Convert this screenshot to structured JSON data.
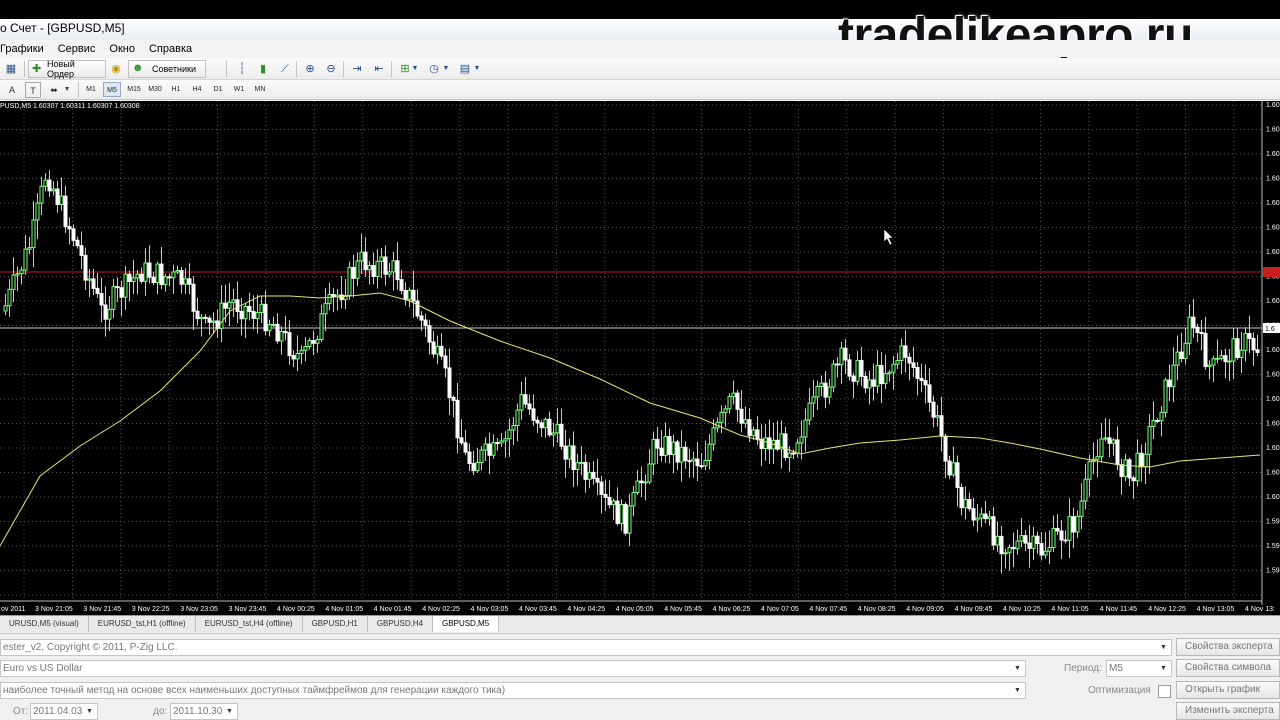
{
  "window": {
    "title": "о Счет - [GBPUSD,M5]",
    "watermark": "tradelikeapro.ru"
  },
  "menu": [
    "Графики",
    "Сервис",
    "Окно",
    "Справка"
  ],
  "toolbar": {
    "new_order": "Новый Ордер",
    "advisors": "Советники",
    "timeframes": [
      "M1",
      "M5",
      "M15",
      "M30",
      "H1",
      "H4",
      "D1",
      "W1",
      "MN"
    ],
    "active_timeframe": "M5",
    "text_tool_a": "A",
    "text_tool_t": "T"
  },
  "chart": {
    "header": "PUSD,M5  1.60307 1.60311 1.60307 1.60308",
    "background": "#000000",
    "grid_color": "#555555",
    "bull_color": "#7cff7c",
    "bear_color": "#ffffff",
    "ma_color": "#e6e67a",
    "hline_red": "#c81e1e",
    "hline_white": "#c8c8c8",
    "price_labels": [
      "1.60",
      "1.60",
      "1.60",
      "1.60",
      "1.60",
      "1.60",
      "1.60",
      "1.60",
      "1.60",
      "1.60",
      "1.60",
      "1.60",
      "1.60",
      "1.60",
      "1.60",
      "1.60",
      "1.60",
      "1.59",
      "1.59",
      "1.59"
    ],
    "time_labels": [
      "ov 2011",
      "3 Nov 21:05",
      "3 Nov 21:45",
      "3 Nov 22:25",
      "3 Nov 23:05",
      "3 Nov 23:45",
      "4 Nov 00:25",
      "4 Nov 01:05",
      "4 Nov 01:45",
      "4 Nov 02:25",
      "4 Nov 03:05",
      "4 Nov 03:45",
      "4 Nov 04:25",
      "4 Nov 05:05",
      "4 Nov 05:45",
      "4 Nov 06:25",
      "4 Nov 07:05",
      "4 Nov 07:45",
      "4 Nov 08:25",
      "4 Nov 09:05",
      "4 Nov 09:45",
      "4 Nov 10:25",
      "4 Nov 11:05",
      "4 Nov 11:45",
      "4 Nov 12:25",
      "4 Nov 13:05",
      "4 Nov 13:"
    ],
    "price_marker": "1.6"
  },
  "tabs": {
    "items": [
      "URUSD,M5 (visual)",
      "EURUSD_tst,H1 (offline)",
      "EURUSD_tst,H4 (offline)",
      "GBPUSD,H1",
      "GBPUSD,H4",
      "GBPUSD,M5"
    ],
    "active": 5
  },
  "tester": {
    "expert": "ester_v2, Copyright © 2011, P-Zig LLC.",
    "symbol": "Euro vs US Dollar",
    "model": "наиболее точный метод на основе всех наименьших доступных таймфреймов для генерации каждого тика)",
    "period_label": "Период:",
    "period_value": "M5",
    "optimization_label": "Оптимизация",
    "from_label": "От:",
    "from_value": "2011.04.03",
    "to_label": "до:",
    "to_value": "2011.10.30",
    "buttons": {
      "expert_props": "Свойства эксперта",
      "symbol_props": "Свойства символа",
      "open_chart": "Открыть график",
      "modify_expert": "Изменить эксперта"
    }
  }
}
